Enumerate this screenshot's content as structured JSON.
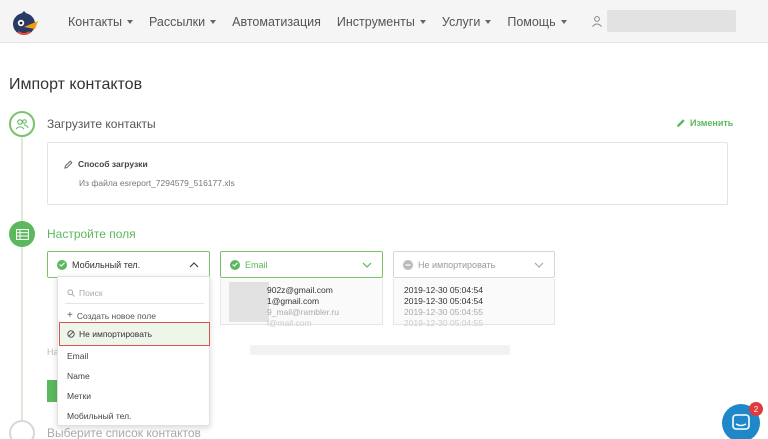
{
  "nav": {
    "items": [
      {
        "label": "Контакты",
        "has_caret": true
      },
      {
        "label": "Рассылки",
        "has_caret": true
      },
      {
        "label": "Автоматизация",
        "has_caret": false
      },
      {
        "label": "Инструменты",
        "has_caret": true
      },
      {
        "label": "Услуги",
        "has_caret": true
      },
      {
        "label": "Помощь",
        "has_caret": true
      }
    ]
  },
  "page": {
    "title": "Импорт контактов"
  },
  "steps": {
    "step1": {
      "label": "Загрузите контакты",
      "edit_label": "Изменить"
    },
    "step2": {
      "label": "Настройте поля"
    },
    "step3": {
      "label": "Выберите список контактов"
    }
  },
  "upload": {
    "method_label": "Способ загрузки",
    "file_text": "Из файла esreport_7294579_516177.xls"
  },
  "fields": {
    "col1": {
      "selected": "Мобильный тел."
    },
    "col2": {
      "selected": "Email",
      "samples": [
        "902z@gmail.com",
        "1@gmail.com",
        "9_mail@rambler.ru",
        "l@mail.com"
      ]
    },
    "col3": {
      "selected": "Не импортировать",
      "samples": [
        "2019-12-30 05:04:54",
        "2019-12-30 05:04:54",
        "2019-12-30 05:04:55",
        "2019-12-30 05:04:55"
      ]
    }
  },
  "dropdown": {
    "search_placeholder": "Поиск",
    "create_label": "Создать новое поле",
    "no_import_label": "Не импортировать",
    "options": [
      "Email",
      "Name",
      "Метки",
      "Мобильный тел."
    ]
  },
  "misc": {
    "hint_prefix": "На"
  },
  "chat": {
    "badge_count": "2"
  },
  "colors": {
    "accent": "#5cb85c",
    "chat": "#1f88c8",
    "badge": "#e03b3b"
  }
}
